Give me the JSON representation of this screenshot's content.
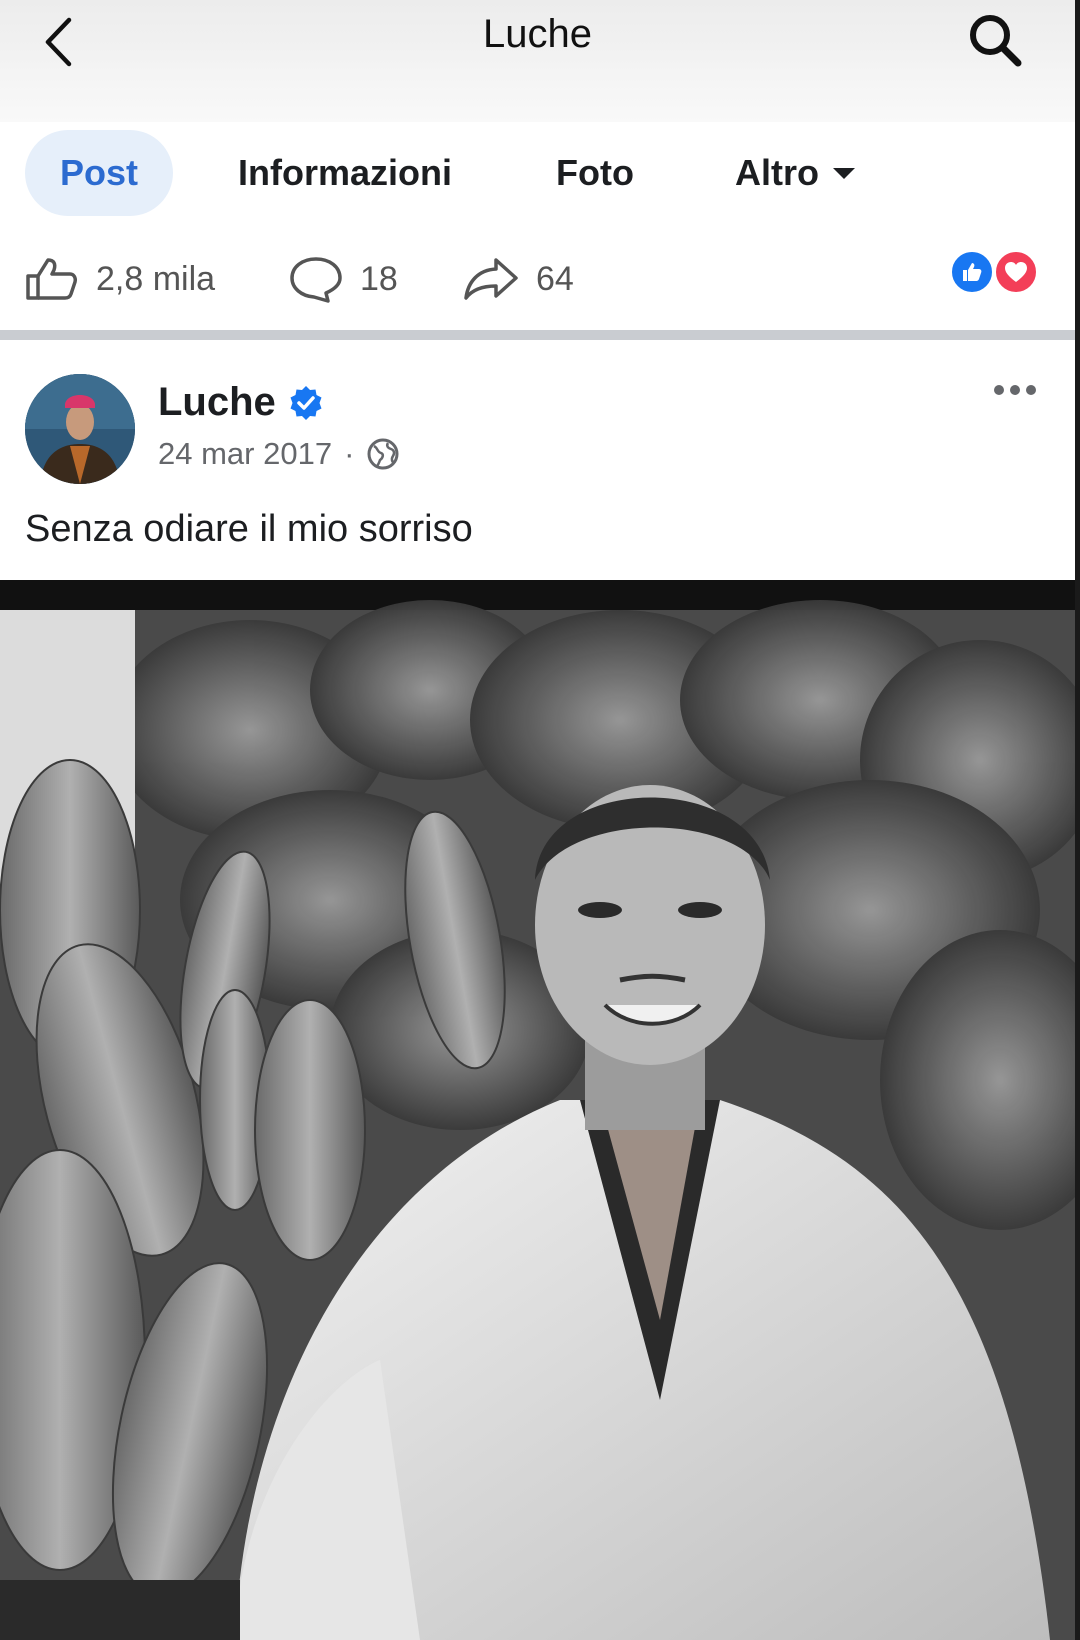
{
  "header": {
    "title": "Luche"
  },
  "tabs": [
    {
      "label": "Post",
      "active": true
    },
    {
      "label": "Informazioni"
    },
    {
      "label": "Foto"
    },
    {
      "label": "Altro"
    }
  ],
  "stats": {
    "likes": "2,8 mila",
    "comments": "18",
    "shares": "64"
  },
  "post": {
    "author": "Luche",
    "date": "24 mar 2017",
    "separator": "·",
    "caption": "Senza odiare il mio sorriso"
  },
  "colors": {
    "accent": "#2c6bd0",
    "active_tab_bg": "#e6effa",
    "like_blue": "#1877f2",
    "love_red": "#f33e58"
  }
}
